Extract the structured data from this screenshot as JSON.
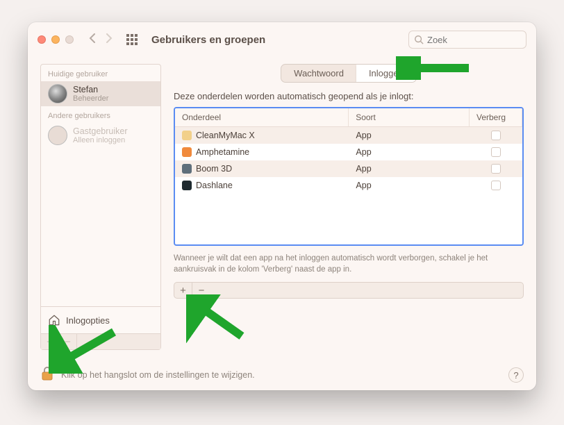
{
  "window": {
    "title": "Gebruikers en groepen"
  },
  "search": {
    "placeholder": "Zoek"
  },
  "sidebar": {
    "current_label": "Huidige gebruiker",
    "current": {
      "name": "Stefan",
      "role": "Beheerder"
    },
    "others_label": "Andere gebruikers",
    "guest": {
      "name": "Gastgebruiker",
      "role": "Alleen inloggen"
    },
    "login_options": "Inlogopties",
    "add": "+",
    "remove": "−"
  },
  "tabs": {
    "password": "Wachtwoord",
    "login": "Inloggen"
  },
  "main": {
    "instruction": "Deze onderdelen worden automatisch geopend als je inlogt:",
    "columns": {
      "item": "Onderdeel",
      "kind": "Soort",
      "hide": "Verberg"
    },
    "rows": [
      {
        "name": "CleanMyMac X",
        "kind": "App",
        "color": "#f2d08a"
      },
      {
        "name": "Amphetamine",
        "kind": "App",
        "color": "#f08a3c"
      },
      {
        "name": "Boom 3D",
        "kind": "App",
        "color": "#5f6f7b"
      },
      {
        "name": "Dashlane",
        "kind": "App",
        "color": "#1f2a2f"
      }
    ],
    "note": "Wanneer je wilt dat een app na het inloggen automatisch wordt verborgen, schakel je het aankruisvak in de kolom 'Verberg' naast de app in.",
    "add": "+",
    "remove": "−"
  },
  "footer": {
    "lock_text": "Klik op het hangslot om de instellingen te wijzigen.",
    "help": "?"
  }
}
